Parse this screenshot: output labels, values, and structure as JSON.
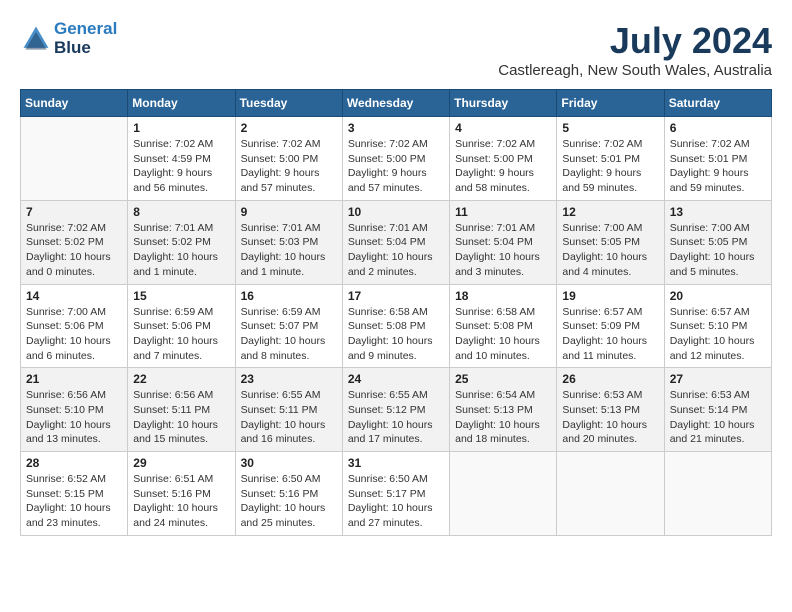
{
  "header": {
    "logo_line1": "General",
    "logo_line2": "Blue",
    "month_year": "July 2024",
    "location": "Castlereagh, New South Wales, Australia"
  },
  "days_of_week": [
    "Sunday",
    "Monday",
    "Tuesday",
    "Wednesday",
    "Thursday",
    "Friday",
    "Saturday"
  ],
  "weeks": [
    [
      {
        "day": "",
        "info": ""
      },
      {
        "day": "1",
        "info": "Sunrise: 7:02 AM\nSunset: 4:59 PM\nDaylight: 9 hours\nand 56 minutes."
      },
      {
        "day": "2",
        "info": "Sunrise: 7:02 AM\nSunset: 5:00 PM\nDaylight: 9 hours\nand 57 minutes."
      },
      {
        "day": "3",
        "info": "Sunrise: 7:02 AM\nSunset: 5:00 PM\nDaylight: 9 hours\nand 57 minutes."
      },
      {
        "day": "4",
        "info": "Sunrise: 7:02 AM\nSunset: 5:00 PM\nDaylight: 9 hours\nand 58 minutes."
      },
      {
        "day": "5",
        "info": "Sunrise: 7:02 AM\nSunset: 5:01 PM\nDaylight: 9 hours\nand 59 minutes."
      },
      {
        "day": "6",
        "info": "Sunrise: 7:02 AM\nSunset: 5:01 PM\nDaylight: 9 hours\nand 59 minutes."
      }
    ],
    [
      {
        "day": "7",
        "info": "Sunrise: 7:02 AM\nSunset: 5:02 PM\nDaylight: 10 hours\nand 0 minutes."
      },
      {
        "day": "8",
        "info": "Sunrise: 7:01 AM\nSunset: 5:02 PM\nDaylight: 10 hours\nand 1 minute."
      },
      {
        "day": "9",
        "info": "Sunrise: 7:01 AM\nSunset: 5:03 PM\nDaylight: 10 hours\nand 1 minute."
      },
      {
        "day": "10",
        "info": "Sunrise: 7:01 AM\nSunset: 5:04 PM\nDaylight: 10 hours\nand 2 minutes."
      },
      {
        "day": "11",
        "info": "Sunrise: 7:01 AM\nSunset: 5:04 PM\nDaylight: 10 hours\nand 3 minutes."
      },
      {
        "day": "12",
        "info": "Sunrise: 7:00 AM\nSunset: 5:05 PM\nDaylight: 10 hours\nand 4 minutes."
      },
      {
        "day": "13",
        "info": "Sunrise: 7:00 AM\nSunset: 5:05 PM\nDaylight: 10 hours\nand 5 minutes."
      }
    ],
    [
      {
        "day": "14",
        "info": "Sunrise: 7:00 AM\nSunset: 5:06 PM\nDaylight: 10 hours\nand 6 minutes."
      },
      {
        "day": "15",
        "info": "Sunrise: 6:59 AM\nSunset: 5:06 PM\nDaylight: 10 hours\nand 7 minutes."
      },
      {
        "day": "16",
        "info": "Sunrise: 6:59 AM\nSunset: 5:07 PM\nDaylight: 10 hours\nand 8 minutes."
      },
      {
        "day": "17",
        "info": "Sunrise: 6:58 AM\nSunset: 5:08 PM\nDaylight: 10 hours\nand 9 minutes."
      },
      {
        "day": "18",
        "info": "Sunrise: 6:58 AM\nSunset: 5:08 PM\nDaylight: 10 hours\nand 10 minutes."
      },
      {
        "day": "19",
        "info": "Sunrise: 6:57 AM\nSunset: 5:09 PM\nDaylight: 10 hours\nand 11 minutes."
      },
      {
        "day": "20",
        "info": "Sunrise: 6:57 AM\nSunset: 5:10 PM\nDaylight: 10 hours\nand 12 minutes."
      }
    ],
    [
      {
        "day": "21",
        "info": "Sunrise: 6:56 AM\nSunset: 5:10 PM\nDaylight: 10 hours\nand 13 minutes."
      },
      {
        "day": "22",
        "info": "Sunrise: 6:56 AM\nSunset: 5:11 PM\nDaylight: 10 hours\nand 15 minutes."
      },
      {
        "day": "23",
        "info": "Sunrise: 6:55 AM\nSunset: 5:11 PM\nDaylight: 10 hours\nand 16 minutes."
      },
      {
        "day": "24",
        "info": "Sunrise: 6:55 AM\nSunset: 5:12 PM\nDaylight: 10 hours\nand 17 minutes."
      },
      {
        "day": "25",
        "info": "Sunrise: 6:54 AM\nSunset: 5:13 PM\nDaylight: 10 hours\nand 18 minutes."
      },
      {
        "day": "26",
        "info": "Sunrise: 6:53 AM\nSunset: 5:13 PM\nDaylight: 10 hours\nand 20 minutes."
      },
      {
        "day": "27",
        "info": "Sunrise: 6:53 AM\nSunset: 5:14 PM\nDaylight: 10 hours\nand 21 minutes."
      }
    ],
    [
      {
        "day": "28",
        "info": "Sunrise: 6:52 AM\nSunset: 5:15 PM\nDaylight: 10 hours\nand 23 minutes."
      },
      {
        "day": "29",
        "info": "Sunrise: 6:51 AM\nSunset: 5:16 PM\nDaylight: 10 hours\nand 24 minutes."
      },
      {
        "day": "30",
        "info": "Sunrise: 6:50 AM\nSunset: 5:16 PM\nDaylight: 10 hours\nand 25 minutes."
      },
      {
        "day": "31",
        "info": "Sunrise: 6:50 AM\nSunset: 5:17 PM\nDaylight: 10 hours\nand 27 minutes."
      },
      {
        "day": "",
        "info": ""
      },
      {
        "day": "",
        "info": ""
      },
      {
        "day": "",
        "info": ""
      }
    ]
  ]
}
